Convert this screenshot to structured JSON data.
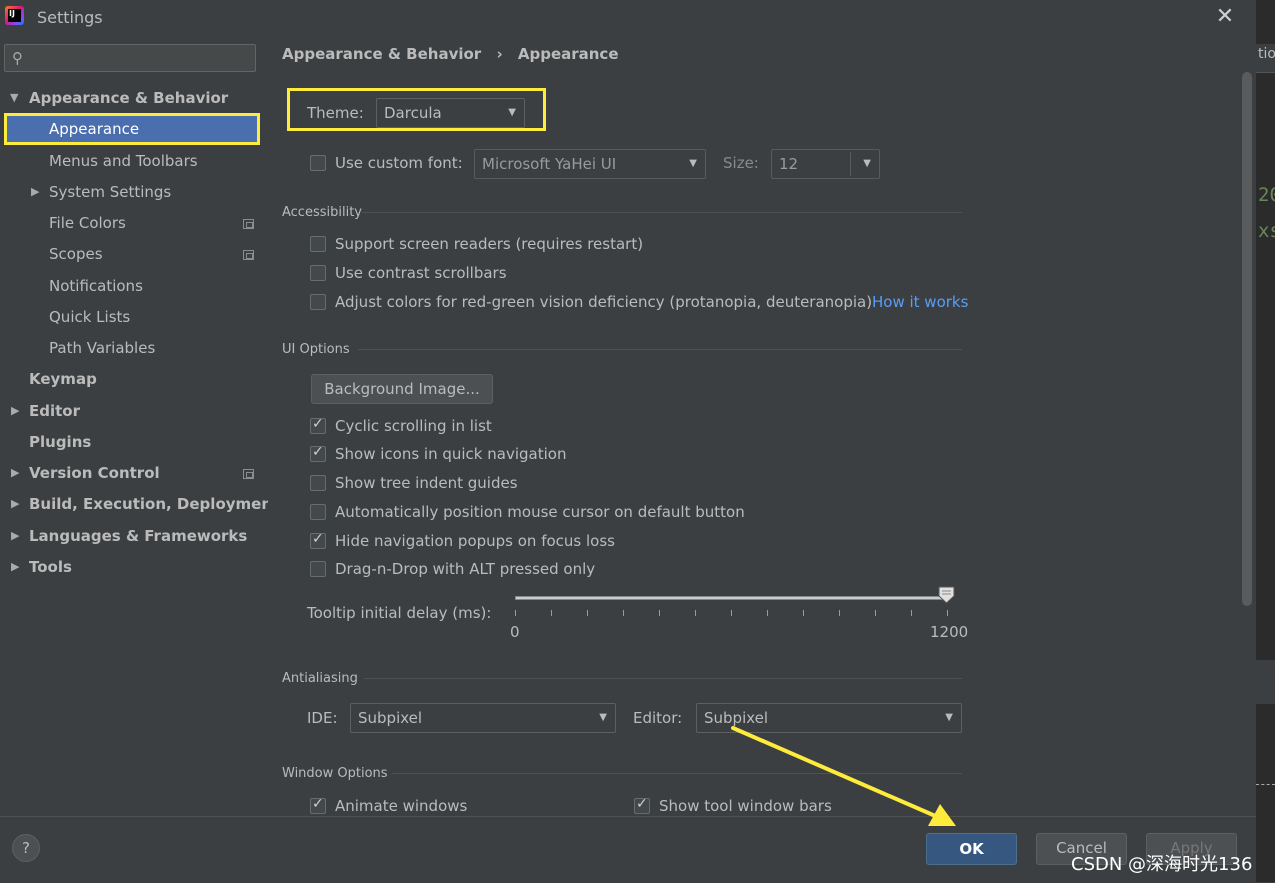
{
  "window": {
    "title": "Settings",
    "app_icon": "intellij-idea-icon",
    "close_icon": "close-icon"
  },
  "search": {
    "placeholder": "",
    "icon": "search-icon"
  },
  "sidebar": {
    "items": [
      {
        "label": "Appearance & Behavior",
        "expanded": true
      },
      {
        "label": "Appearance",
        "selected": true
      },
      {
        "label": "Menus and Toolbars"
      },
      {
        "label": "System Settings",
        "expandable": true
      },
      {
        "label": "File Colors"
      },
      {
        "label": "Scopes"
      },
      {
        "label": "Notifications"
      },
      {
        "label": "Quick Lists"
      },
      {
        "label": "Path Variables"
      },
      {
        "label": "Keymap"
      },
      {
        "label": "Editor",
        "expandable": true
      },
      {
        "label": "Plugins"
      },
      {
        "label": "Version Control",
        "expandable": true
      },
      {
        "label": "Build, Execution, Deployment",
        "expandable": true
      },
      {
        "label": "Languages & Frameworks",
        "expandable": true
      },
      {
        "label": "Tools",
        "expandable": true
      }
    ]
  },
  "breadcrumb": {
    "parent": "Appearance & Behavior",
    "separator": "›",
    "current": "Appearance"
  },
  "theme": {
    "label": "Theme:",
    "value": "Darcula"
  },
  "custom_font": {
    "label": "Use custom font:",
    "checked": false,
    "font": "Microsoft YaHei UI",
    "size_label": "Size:",
    "size": "12"
  },
  "accessibility": {
    "title": "Accessibility",
    "options": [
      {
        "label": "Support screen readers (requires restart)",
        "checked": false
      },
      {
        "label": "Use contrast scrollbars",
        "checked": false
      },
      {
        "label": "Adjust colors for red-green vision deficiency (protanopia, deuteranopia)",
        "checked": false
      }
    ],
    "link": "How it works"
  },
  "ui_options": {
    "title": "UI Options",
    "background_button": "Background Image...",
    "options": [
      {
        "label": "Cyclic scrolling in list",
        "checked": true
      },
      {
        "label": "Show icons in quick navigation",
        "checked": true
      },
      {
        "label": "Show tree indent guides",
        "checked": false
      },
      {
        "label": "Automatically position mouse cursor on default button",
        "checked": false
      },
      {
        "label": "Hide navigation popups on focus loss",
        "checked": true
      },
      {
        "label": "Drag-n-Drop with ALT pressed only",
        "checked": false
      }
    ],
    "tooltip_label": "Tooltip initial delay (ms):",
    "tooltip_min": "0",
    "tooltip_max": "1200",
    "tooltip_value": 1200
  },
  "antialiasing": {
    "title": "Antialiasing",
    "ide_label": "IDE:",
    "ide_value": "Subpixel",
    "editor_label": "Editor:",
    "editor_value": "Subpixel"
  },
  "window_options": {
    "title": "Window Options",
    "options": [
      {
        "label": "Animate windows",
        "checked": true
      },
      {
        "label": "Show tool window bars",
        "checked": true
      }
    ]
  },
  "footer": {
    "help": "?",
    "ok": "OK",
    "cancel": "Cancel",
    "apply": "Apply"
  },
  "background_editor": {
    "fragments": [
      "tio",
      "20",
      "xs"
    ]
  },
  "watermark": "CSDN @深海时光136",
  "colors": {
    "highlight": "#ffeb3b",
    "selection": "#4b6eaf",
    "ok_button": "#365880",
    "link": "#589df6"
  }
}
